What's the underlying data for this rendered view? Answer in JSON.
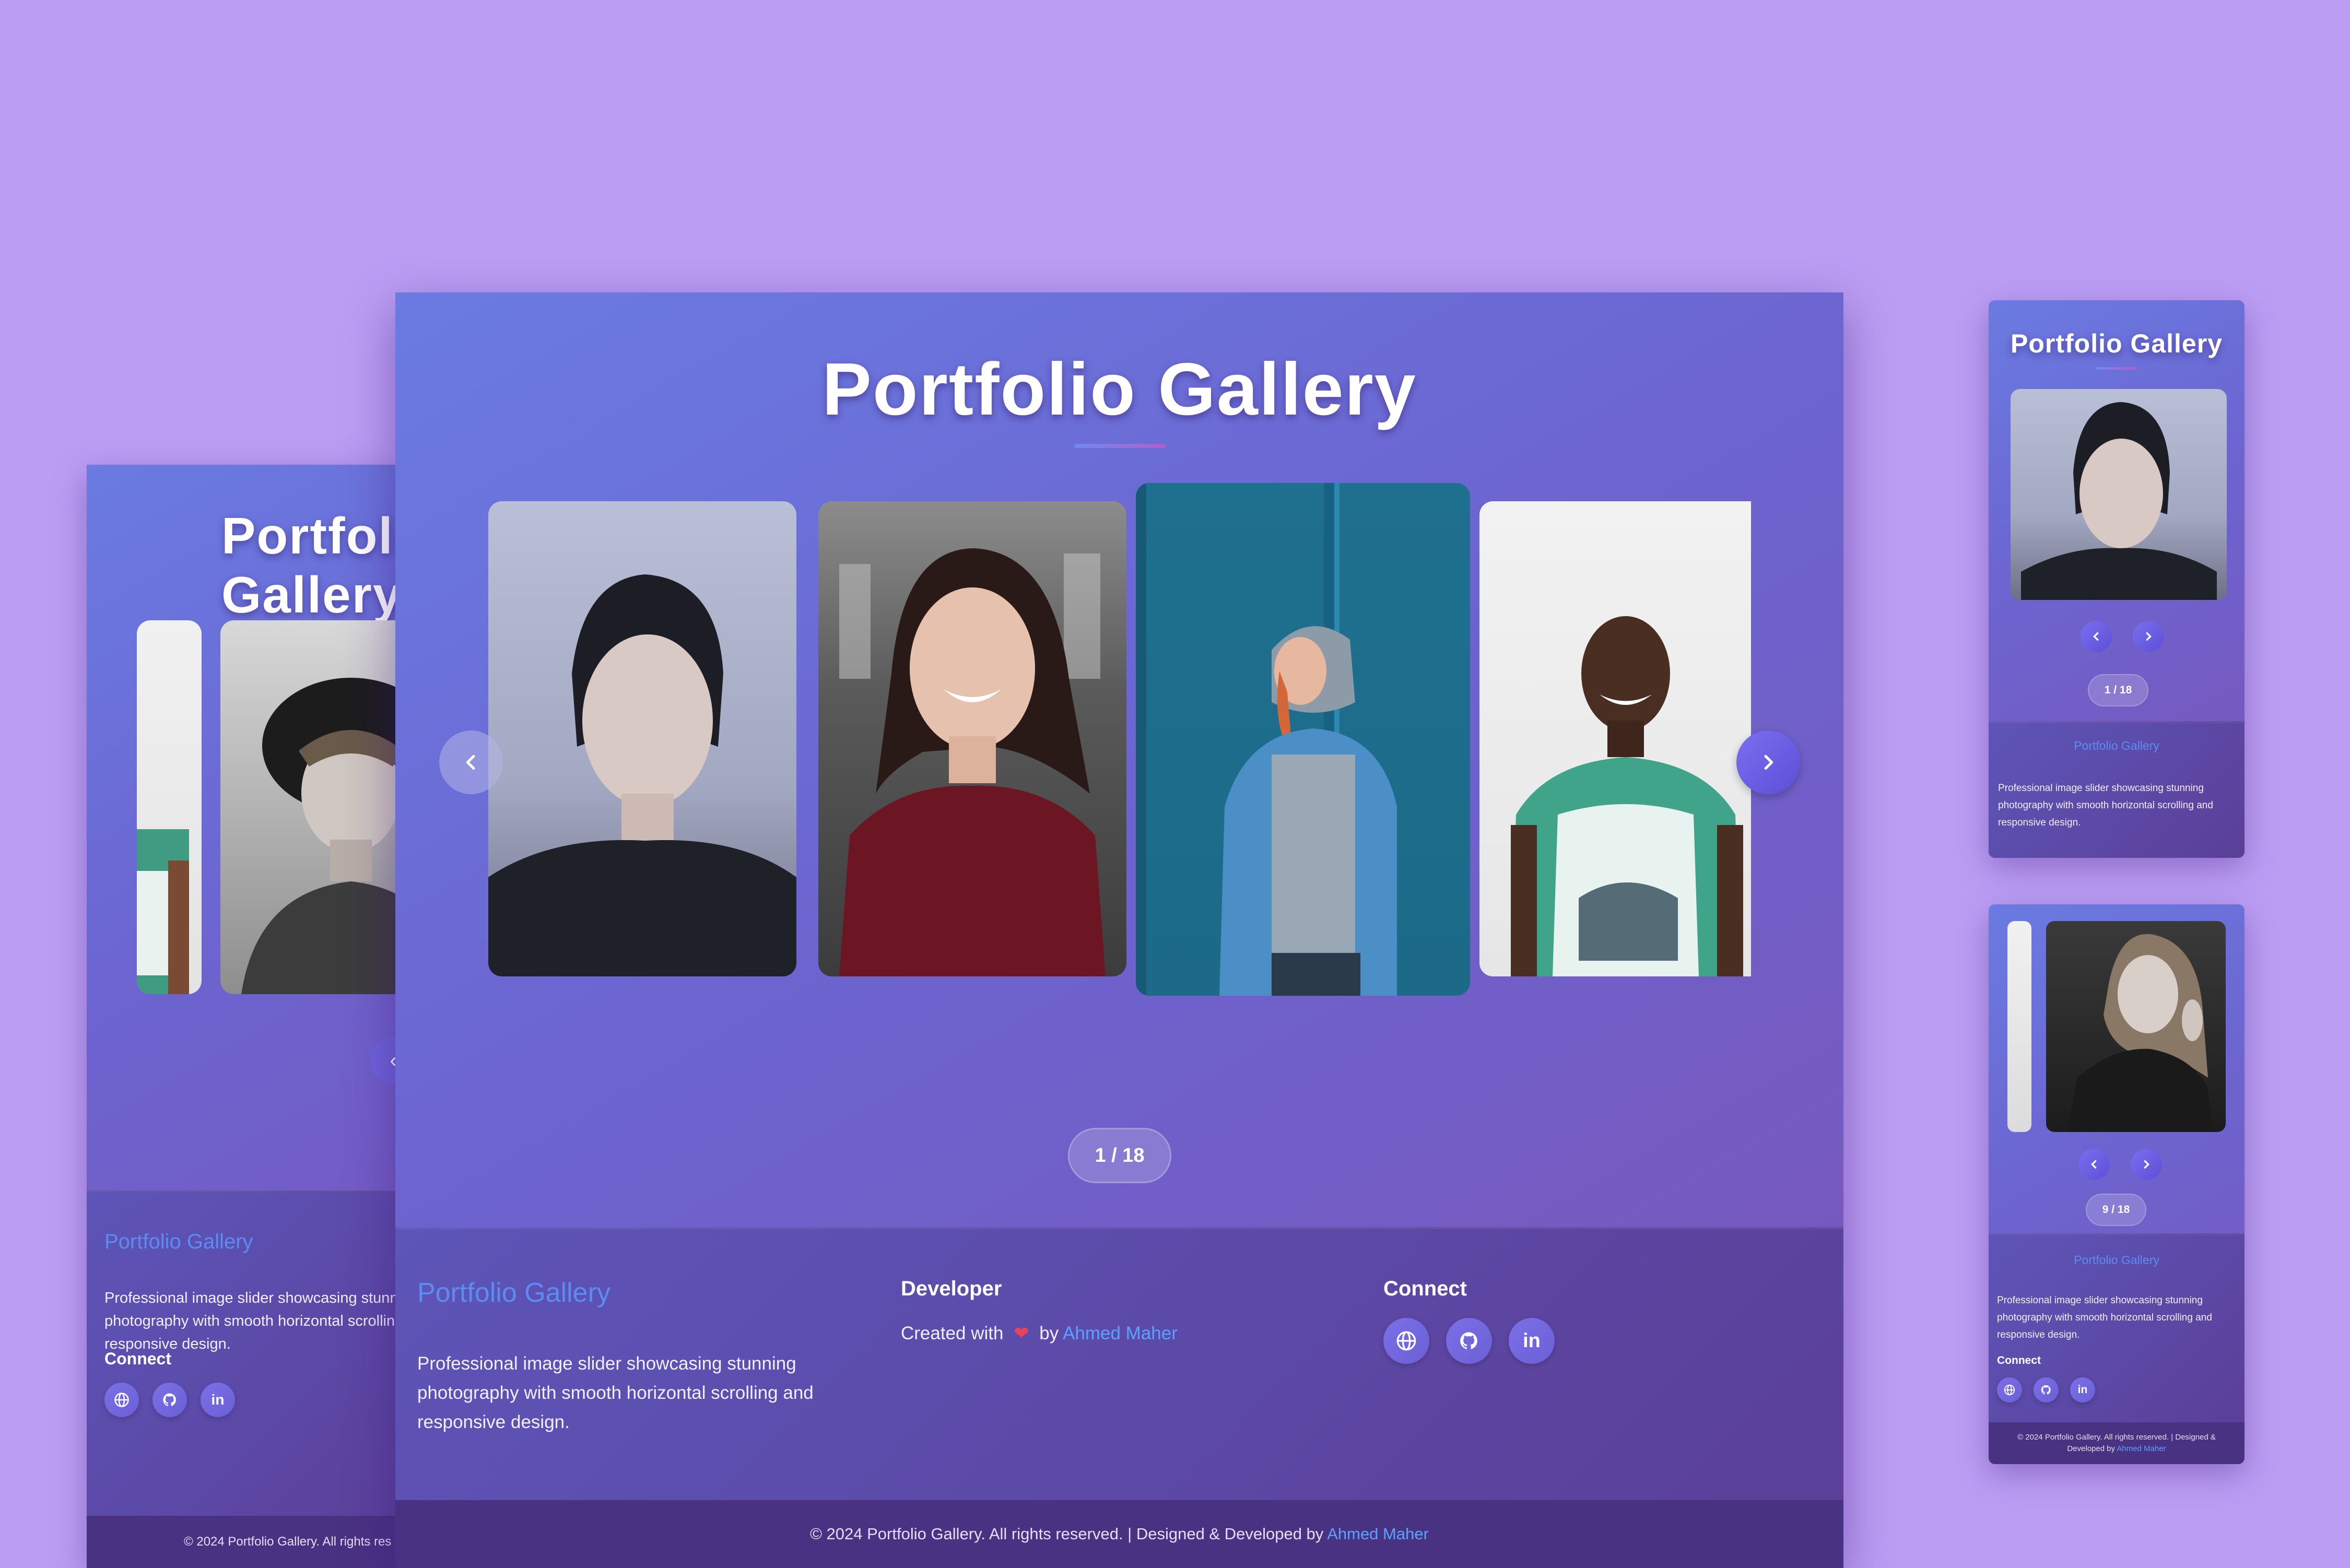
{
  "page_title": "Portfolio Gallery",
  "slider": {
    "counter_main": "1 / 18",
    "counter_mobile_1": "1 / 18",
    "counter_mobile_2": "9 / 18"
  },
  "footer": {
    "brand": "Portfolio Gallery",
    "description": "Professional image slider showcasing stunning photography with smooth horizontal scrolling and responsive design.",
    "developer_heading": "Developer",
    "created_with": "Created with",
    "by": "by",
    "author": "Ahmed Maher",
    "connect_heading": "Connect",
    "copyright_prefix": "© 2024 Portfolio Gallery. All rights reserved. | Designed & Developed by",
    "copyright_author": "Ahmed Maher",
    "copyright_short": "© 2024 Portfolio Gallery. All rights res",
    "copyright_mobile_line1": "© 2024 Portfolio Gallery. All rights reserved. | Designed &",
    "copyright_mobile_line2": "Developed by"
  },
  "icons": {
    "prev": "chevron-left-icon",
    "next": "chevron-right-icon",
    "website": "globe-icon",
    "github": "github-icon",
    "linkedin": "linkedin-icon",
    "heart": "heart-icon"
  },
  "colors": {
    "background": "#bb9ef4",
    "accent_link": "#59a3ff",
    "brand_text": "#5b8cf2",
    "heart": "#e8435a"
  }
}
